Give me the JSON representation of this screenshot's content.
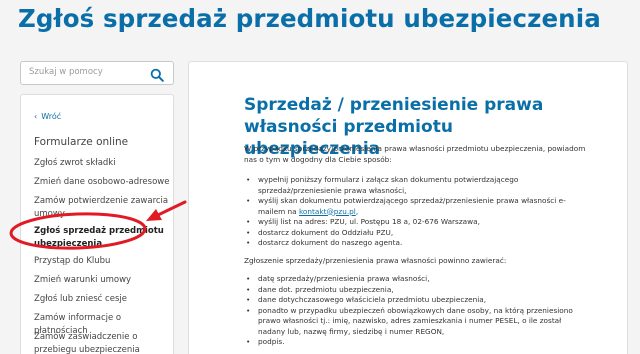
{
  "page_title": "Zgłoś sprzedaż przedmiotu ubezpieczenia",
  "search": {
    "placeholder": "Szukaj w pomocy",
    "icon": "search-icon"
  },
  "sidebar": {
    "back_label": "Wróć",
    "section_title": "Formularze online",
    "items": [
      {
        "label": "Zgłoś zwrot składki"
      },
      {
        "label": "Zmień dane osobowo-adresowe"
      },
      {
        "label": "Zamów potwierdzenie zawarcia umowy"
      },
      {
        "label": "Zgłoś sprzedaż przedmiotu ubezpieczenia",
        "active": true
      },
      {
        "label": "Przystąp do Klubu"
      },
      {
        "label": "Zmień warunki umowy"
      },
      {
        "label": "Zgłoś lub zniesć cesje"
      },
      {
        "label": "Zamów informacje o płatnościach"
      },
      {
        "label": "Zamów zaświadczenie o przebiegu ubezpieczenia komunikacyjnego"
      }
    ]
  },
  "content": {
    "title": "Sprzedaż / przeniesienie prawa własności przedmiotu ubezpieczenia",
    "intro": "W przypadku sprzedaży/przeniesienia prawa własności przedmiotu ubezpieczenia, powiadom nas o tym w dogodny dla Ciebie sposób:",
    "methods": [
      {
        "text": "wypełnij poniższy formularz i załącz skan dokumentu potwierdzającego sprzedaż/przeniesienie prawa własności,"
      },
      {
        "text": "wyślij skan dokumentu potwierdzającego sprzedaż/przeniesienie prawa własności e-mailem na ",
        "link": "kontakt@pzu.pl",
        "after": ","
      },
      {
        "text": "wyślij list na adres: PZU, ul. Postępu 18 a, 02-676 Warszawa,"
      },
      {
        "text": "dostarcz dokument do Oddziału PZU,"
      },
      {
        "text": "dostarcz dokument do naszego agenta."
      }
    ],
    "requirements_intro": "Zgłoszenie sprzedaży/przeniesienia prawa własności powinno zawierać:",
    "requirements": [
      "datę sprzedaży/przeniesienia prawa własności,",
      "dane dot. przedmiotu ubezpieczenia,",
      "dane dotychczasowego właściciela przedmiotu ubezpieczenia,",
      "ponadto w przypadku ubezpieczeń obowiązkowych dane osoby, na którą przeniesiono prawo własności tj.: imię, nazwisko, adres zamieszkania i numer PESEL, o ile został nadany lub, nazwę firmy, siedzibę i numer REGON,",
      "podpis."
    ]
  },
  "annotation": {
    "color": "#e01b24"
  },
  "colors": {
    "accent": "#0a6fa8",
    "background": "#f4f4f4",
    "panel": "#ffffff"
  }
}
